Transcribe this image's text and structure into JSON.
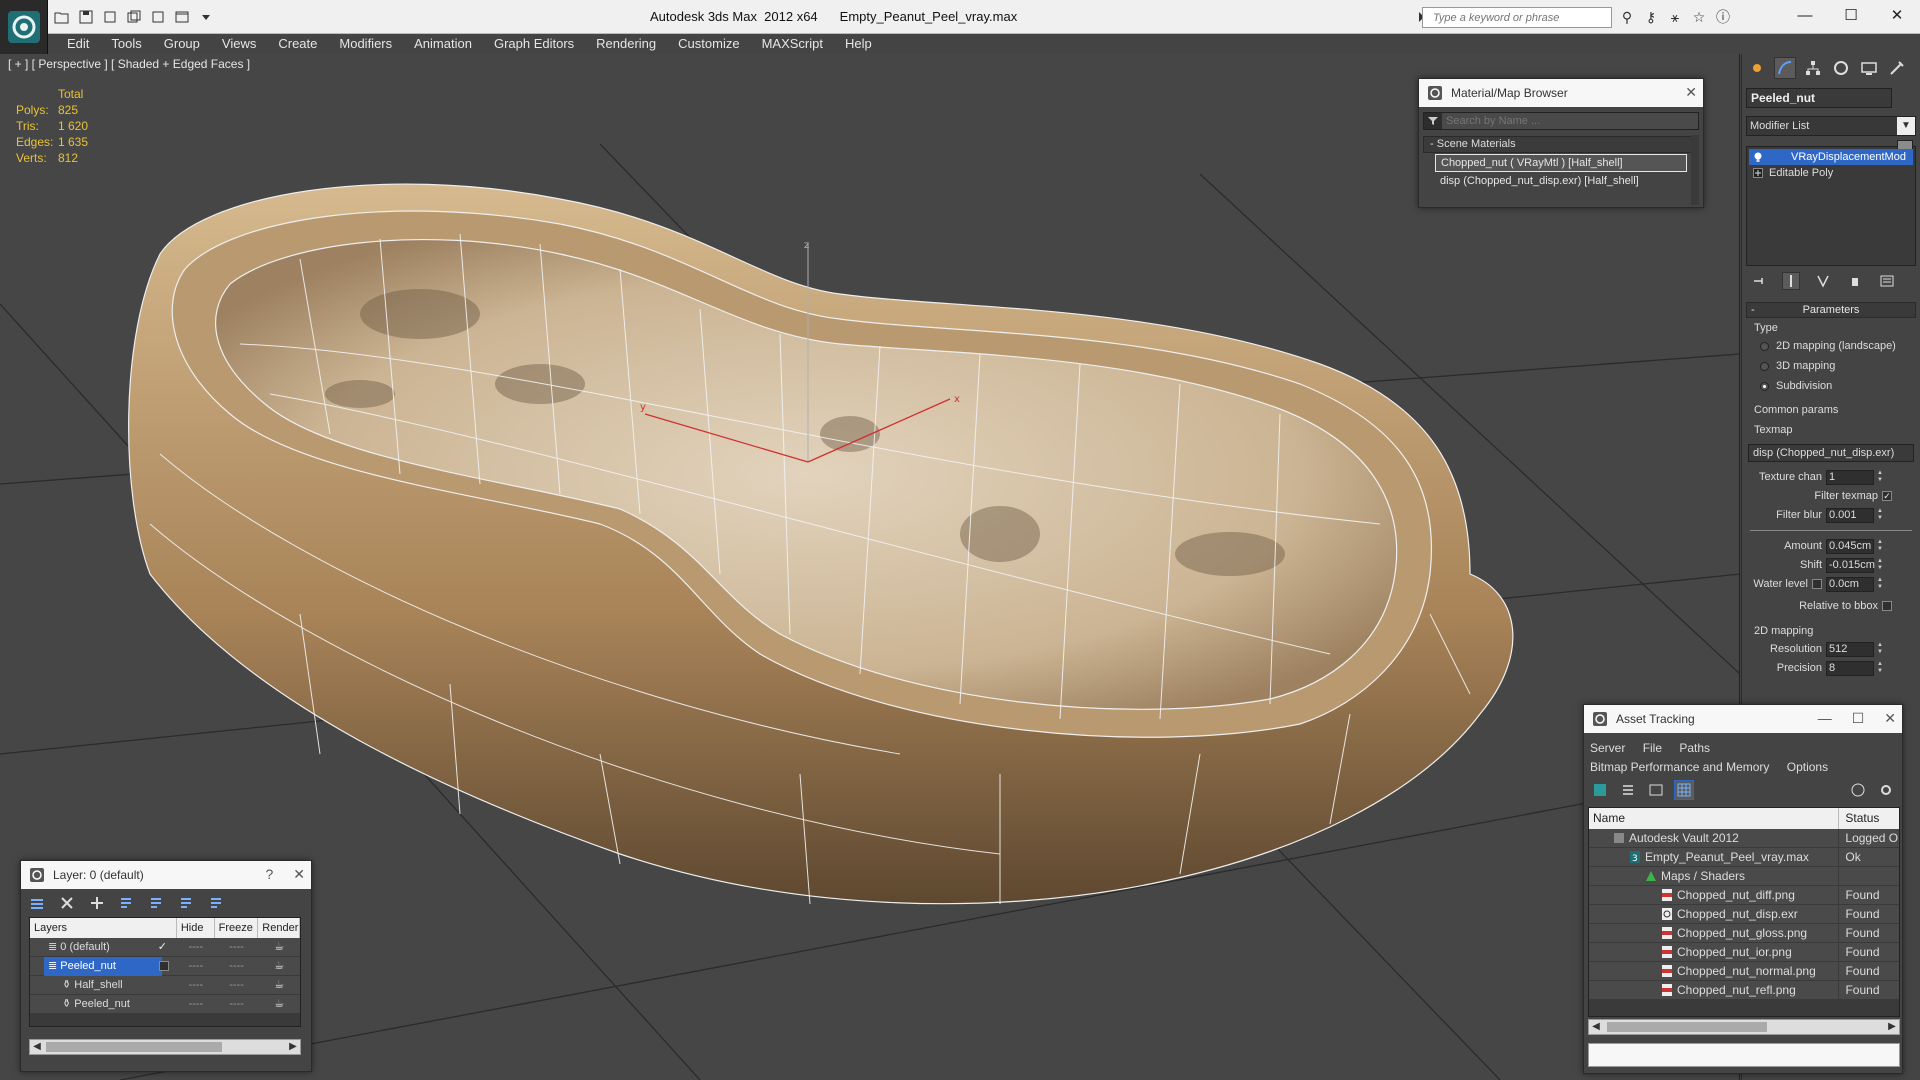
{
  "titlebar": {
    "app_title": "Autodesk 3ds Max  2012 x64",
    "file_name": "Empty_Peanut_Peel_vray.max",
    "search_placeholder": "Type a keyword or phrase"
  },
  "menu": [
    "Edit",
    "Tools",
    "Group",
    "Views",
    "Create",
    "Modifiers",
    "Animation",
    "Graph Editors",
    "Rendering",
    "Customize",
    "MAXScript",
    "Help"
  ],
  "viewport": {
    "label": "[ + ] [ Perspective ] [ Shaded + Edged Faces ]",
    "stats_header": "Total",
    "stats": [
      {
        "label": "Polys:",
        "value": "825"
      },
      {
        "label": "Tris:",
        "value": "1 620"
      },
      {
        "label": "Edges:",
        "value": "1 635"
      },
      {
        "label": "Verts:",
        "value": "812"
      }
    ],
    "axis_labels": {
      "x": "x",
      "y": "y",
      "z": "z"
    }
  },
  "material_browser": {
    "title": "Material/Map Browser",
    "search_placeholder": "Search by Name ...",
    "section": "Scene Materials",
    "items": [
      "Chopped_nut  ( VRayMtl ) [Half_shell]",
      "disp (Chopped_nut_disp.exr) [Half_shell]"
    ]
  },
  "command_panel": {
    "object_name": "Peeled_nut",
    "modifier_list": "Modifier List",
    "stack": [
      "VRayDisplacementMod",
      "Editable Poly"
    ],
    "parameters_header": "Parameters",
    "type_label": "Type",
    "type_options": [
      "2D mapping (landscape)",
      "3D mapping",
      "Subdivision"
    ],
    "type_selected": "Subdivision",
    "common_params": "Common params",
    "texmap_label": "Texmap",
    "texmap_value": "disp (Chopped_nut_disp.exr)",
    "texture_chan_label": "Texture chan",
    "texture_chan_value": "1",
    "filter_texmap_label": "Filter texmap",
    "filter_blur_label": "Filter blur",
    "filter_blur_value": "0.001",
    "amount_label": "Amount",
    "amount_value": "0.045cm",
    "shift_label": "Shift",
    "shift_value": "-0.015cm",
    "water_level_label": "Water level",
    "water_level_value": "0.0cm",
    "relative_bbox_label": "Relative to bbox",
    "mapping_2d": "2D mapping",
    "resolution_label": "Resolution",
    "resolution_value": "512",
    "precision_label": "Precision",
    "precision_value": "8"
  },
  "layer_manager": {
    "title": "Layer: 0 (default)",
    "help": "?",
    "columns": [
      "Layers",
      "Hide",
      "Freeze",
      "Render"
    ],
    "rows": [
      {
        "name": "0 (default)",
        "indent": 1
      },
      {
        "name": "Peeled_nut",
        "indent": 1
      },
      {
        "name": "Half_shell",
        "indent": 2
      },
      {
        "name": "Peeled_nut",
        "indent": 2
      }
    ]
  },
  "asset_tracking": {
    "title": "Asset Tracking",
    "menu_row1": [
      "Server",
      "File",
      "Paths"
    ],
    "menu_row2": [
      "Bitmap Performance and Memory",
      "Options"
    ],
    "columns": [
      "Name",
      "Status"
    ],
    "rows": [
      {
        "name": "Autodesk Vault 2012",
        "status": "Logged O",
        "indent": 0,
        "icon": "vault-icon"
      },
      {
        "name": "Empty_Peanut_Peel_vray.max",
        "status": "Ok",
        "indent": 1,
        "icon": "max-file-icon"
      },
      {
        "name": "Maps / Shaders",
        "status": "",
        "indent": 2,
        "icon": "maps-icon"
      },
      {
        "name": "Chopped_nut_diff.png",
        "status": "Found",
        "indent": 3,
        "icon": "png-icon"
      },
      {
        "name": "Chopped_nut_disp.exr",
        "status": "Found",
        "indent": 3,
        "icon": "exr-icon"
      },
      {
        "name": "Chopped_nut_gloss.png",
        "status": "Found",
        "indent": 3,
        "icon": "png-icon"
      },
      {
        "name": "Chopped_nut_ior.png",
        "status": "Found",
        "indent": 3,
        "icon": "png-icon"
      },
      {
        "name": "Chopped_nut_normal.png",
        "status": "Found",
        "indent": 3,
        "icon": "png-icon"
      },
      {
        "name": "Chopped_nut_refl.png",
        "status": "Found",
        "indent": 3,
        "icon": "png-icon"
      }
    ]
  },
  "colors": {
    "stats_yellow": "#e8c23a",
    "selection_blue": "#2f67c7",
    "shell_tan": "#c8a67a"
  }
}
